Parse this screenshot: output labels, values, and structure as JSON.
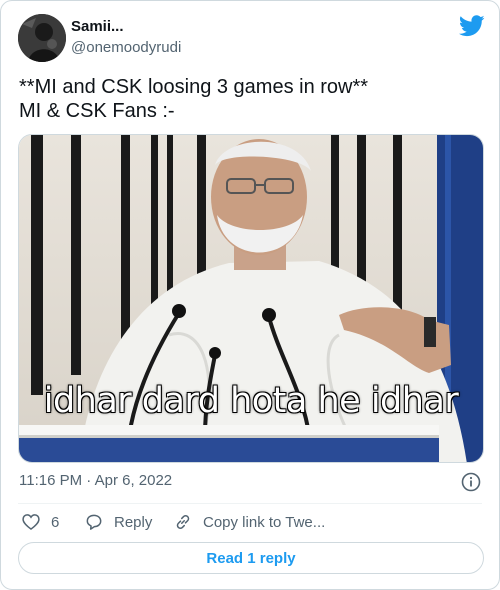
{
  "author": {
    "display_name": "Samii...",
    "handle": "@onemoodyrudi"
  },
  "tweet": {
    "text": "**MI and CSK loosing 3 games in row**\nMI & CSK Fans :-"
  },
  "media": {
    "caption": "idhar dard hota he idhar"
  },
  "meta": {
    "timestamp": "11:16 PM · Apr 6, 2022"
  },
  "actions": {
    "like_count": "6",
    "reply_label": "Reply",
    "copy_label": "Copy link to Twe..."
  },
  "footer": {
    "read_replies_label": "Read 1 reply"
  },
  "icons": {
    "brand": "twitter-bird-icon",
    "info": "info-icon",
    "like": "heart-icon",
    "reply": "reply-bubble-icon",
    "copy": "link-icon"
  },
  "colors": {
    "accent": "#1d9bf0",
    "text_primary": "#0f1419",
    "text_secondary": "#536471",
    "border": "#cfd9de"
  }
}
